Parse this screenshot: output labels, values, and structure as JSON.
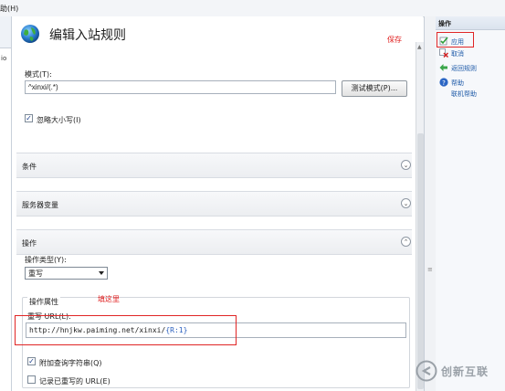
{
  "menu": {
    "partial_item": "助(H)"
  },
  "left_panel": {
    "partial_text": "io"
  },
  "page": {
    "title": "编辑入站规则"
  },
  "annotations": {
    "save": "保存",
    "fill_here": "填这里"
  },
  "pattern": {
    "label": "模式(T):",
    "value": "^xinxi/(.*)",
    "test_button": "测试模式(P)...",
    "ignore_case_label": "忽略大小写(I)",
    "ignore_case_checked": true
  },
  "sections": {
    "conditions": "条件",
    "server_variables": "服务器变量",
    "action": "操作"
  },
  "action": {
    "type_label": "操作类型(Y):",
    "type_value": "重写",
    "properties_group": "操作属性",
    "rewrite_url_label": "重写 URL(L):",
    "rewrite_url_prefix": "http://hnjkw.paiming.net/xinxi/",
    "rewrite_url_token": "{R:1}",
    "append_query_label": "附加查询字符串(Q)",
    "append_query_checked": true,
    "log_rewritten_label": "记录已重写的 URL(E)",
    "log_rewritten_checked": false
  },
  "actions_pane": {
    "header": "操作",
    "apply": "应用",
    "cancel": "取消",
    "back_to_rules": "返回规则",
    "help": "帮助",
    "online_help": "联机帮助"
  },
  "watermark": {
    "text": "创新互联"
  },
  "colors": {
    "annotation_red": "#e02020",
    "link_blue": "#1e5aa8",
    "accent_green": "#2e9e3a"
  }
}
